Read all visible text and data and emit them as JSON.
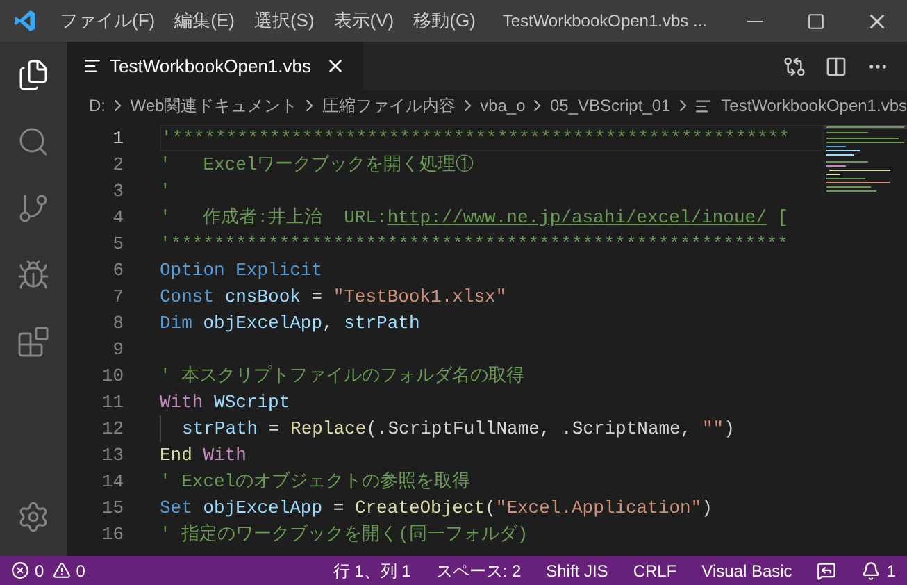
{
  "title_bar": {
    "menu": [
      "ファイル(F)",
      "編集(E)",
      "選択(S)",
      "表示(V)",
      "移動(G)"
    ],
    "title": "TestWorkbookOpen1.vbs ..."
  },
  "activity_bar": [
    {
      "selected": true
    },
    {
      "selected": false
    },
    {
      "selected": false
    },
    {
      "selected": false
    },
    {
      "selected": false
    }
  ],
  "tabs": [
    {
      "label": "TestWorkbookOpen1.vbs",
      "selected": true
    }
  ],
  "breadcrumb": [
    "D:",
    "Web関連ドキュメント",
    "圧縮ファイル内容",
    "vba_o",
    "05_VBScript_01",
    "TestWorkbookOpen1.vbs"
  ],
  "editor": {
    "lines": [
      {
        "number": "1",
        "selected": true,
        "tokens": [
          {
            "kind": "comment",
            "text": "'*********************************************************"
          }
        ]
      },
      {
        "number": "2",
        "tokens": [
          {
            "kind": "comment",
            "text": "'   Excelワークブックを開く処理①"
          }
        ]
      },
      {
        "number": "3",
        "tokens": [
          {
            "kind": "comment",
            "text": "'"
          }
        ]
      },
      {
        "number": "4",
        "tokens": [
          {
            "kind": "comment",
            "text": "'   作成者:井上治  URL:"
          },
          {
            "kind": "link",
            "text": "http://www.ne.jp/asahi/excel/inoue/"
          },
          {
            "kind": "comment",
            "text": " ["
          }
        ]
      },
      {
        "number": "5",
        "tokens": [
          {
            "kind": "comment",
            "text": "'*********************************************************"
          }
        ]
      },
      {
        "number": "6",
        "tokens": [
          {
            "kind": "keyword",
            "text": "Option Explicit"
          }
        ]
      },
      {
        "number": "7",
        "tokens": [
          {
            "kind": "keyword",
            "text": "Const "
          },
          {
            "kind": "variable",
            "text": "cnsBook"
          },
          {
            "kind": "plain",
            "text": " = "
          },
          {
            "kind": "string",
            "text": "\"TestBook1.xlsx\""
          }
        ]
      },
      {
        "number": "8",
        "tokens": [
          {
            "kind": "keyword",
            "text": "Dim "
          },
          {
            "kind": "variable",
            "text": "objExcelApp"
          },
          {
            "kind": "plain",
            "text": ", "
          },
          {
            "kind": "variable",
            "text": "strPath"
          }
        ]
      },
      {
        "number": "9"
      },
      {
        "number": "10",
        "tokens": [
          {
            "kind": "comment",
            "text": "' 本スクリプトファイルのフォルダ名の取得"
          }
        ]
      },
      {
        "number": "11",
        "tokens": [
          {
            "kind": "control",
            "text": "With "
          },
          {
            "kind": "variable",
            "text": "WScript"
          }
        ]
      },
      {
        "number": "12",
        "indent": true,
        "tokens": [
          {
            "kind": "variable",
            "text": "strPath"
          },
          {
            "kind": "plain",
            "text": " = "
          },
          {
            "kind": "function",
            "text": "Replace"
          },
          {
            "kind": "plain",
            "text": "(.ScriptFullName, .ScriptName, "
          },
          {
            "kind": "string",
            "text": "\"\""
          },
          {
            "kind": "plain",
            "text": ")"
          }
        ]
      },
      {
        "number": "13",
        "tokens": [
          {
            "kind": "function",
            "text": "End "
          },
          {
            "kind": "control",
            "text": "With"
          }
        ]
      },
      {
        "number": "14",
        "tokens": [
          {
            "kind": "comment",
            "text": "' Excelのオブジェクトの参照を取得"
          }
        ]
      },
      {
        "number": "15",
        "tokens": [
          {
            "kind": "keyword",
            "text": "Set "
          },
          {
            "kind": "variable",
            "text": "objExcelApp"
          },
          {
            "kind": "plain",
            "text": " = "
          },
          {
            "kind": "function",
            "text": "CreateObject"
          },
          {
            "kind": "plain",
            "text": "("
          },
          {
            "kind": "string",
            "text": "\"Excel.Application\""
          },
          {
            "kind": "plain",
            "text": ")"
          }
        ]
      },
      {
        "number": "16",
        "tokens": [
          {
            "kind": "comment",
            "text": "' 指定のワークブックを開く(同一フォルダ)"
          }
        ]
      }
    ]
  },
  "status_bar": {
    "errors": "0",
    "warnings": "0",
    "items": [
      "行 1、列 1",
      "スペース: 2",
      "Shift JIS",
      "CRLF",
      "Visual Basic"
    ],
    "notifications": "1"
  }
}
